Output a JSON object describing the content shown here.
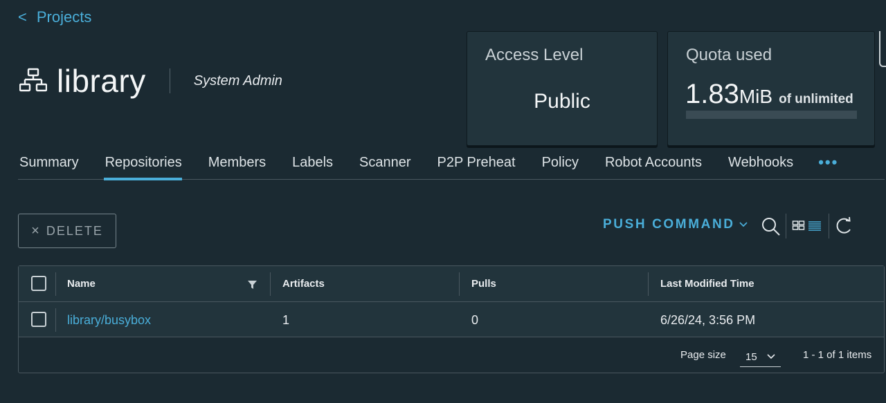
{
  "nav": {
    "back_label": "Projects"
  },
  "project": {
    "name": "library",
    "role": "System Admin"
  },
  "access_card": {
    "title": "Access Level",
    "value": "Public"
  },
  "quota_card": {
    "title": "Quota used",
    "value": "1.83",
    "unit": "MiB",
    "of_text": "of unlimited",
    "usage_fraction": 0
  },
  "tabs": [
    {
      "label": "Summary",
      "active": false
    },
    {
      "label": "Repositories",
      "active": true
    },
    {
      "label": "Members",
      "active": false
    },
    {
      "label": "Labels",
      "active": false
    },
    {
      "label": "Scanner",
      "active": false
    },
    {
      "label": "P2P Preheat",
      "active": false
    },
    {
      "label": "Policy",
      "active": false
    },
    {
      "label": "Robot Accounts",
      "active": false
    },
    {
      "label": "Webhooks",
      "active": false
    }
  ],
  "tabs_more": "•••",
  "toolbar": {
    "delete_label": "DELETE",
    "push_command_label": "PUSH COMMAND"
  },
  "table": {
    "columns": [
      "Name",
      "Artifacts",
      "Pulls",
      "Last Modified Time"
    ],
    "rows": [
      {
        "name": "library/busybox",
        "artifacts": "1",
        "pulls": "0",
        "modified": "6/26/24, 3:56 PM"
      }
    ],
    "footer": {
      "page_size_label": "Page size",
      "page_size_value": "15",
      "items_text": "1 - 1 of 1 items"
    }
  },
  "colors": {
    "accent": "#4aaed9",
    "background": "#1b2a32",
    "card": "#22343c"
  }
}
